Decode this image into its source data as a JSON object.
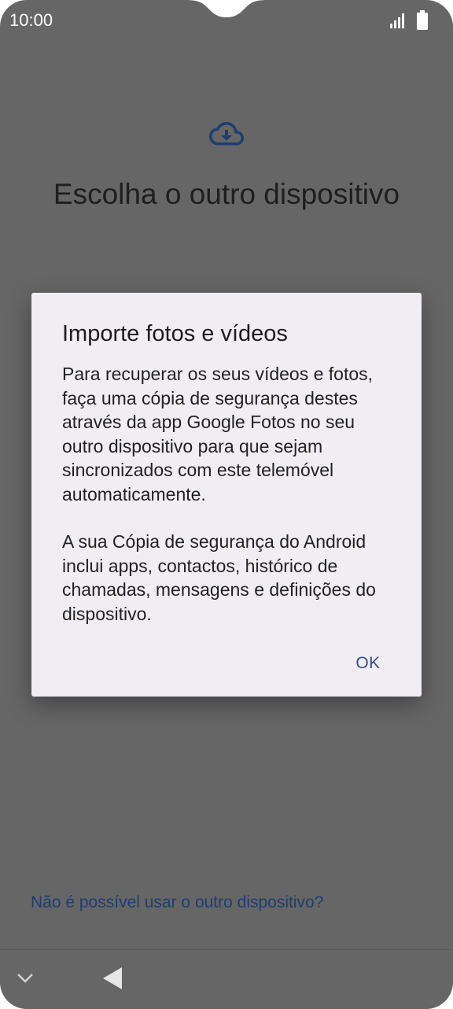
{
  "status_bar": {
    "time": "10:00"
  },
  "icons": {
    "cloud": "cloud-download-icon",
    "signal": "signal-icon",
    "battery": "battery-icon",
    "nav_down": "chevron-down-icon",
    "nav_back": "back-triangle-icon"
  },
  "screen": {
    "title": "Escolha o outro dispositivo",
    "help_link": "Não é possível usar o outro dispositivo?"
  },
  "dialog": {
    "title": "Importe fotos e vídeos",
    "paragraph_1": "Para recuperar os seus vídeos e fotos, faça uma cópia de segurança destes através da app Google Fotos no seu outro dispositivo para que sejam sincronizados com este telemóvel automaticamente.",
    "paragraph_2": "A sua Cópia de segurança do Android inclui apps, contactos, histórico de chamadas, mensagens e definições do dispositivo.",
    "ok_label": "OK"
  },
  "colors": {
    "scrim_background": "#666666",
    "dialog_background": "#f0eef2",
    "accent_text": "#3b4a8c",
    "link_text": "#1d3e72",
    "icon_blue": "#1d3e72"
  }
}
